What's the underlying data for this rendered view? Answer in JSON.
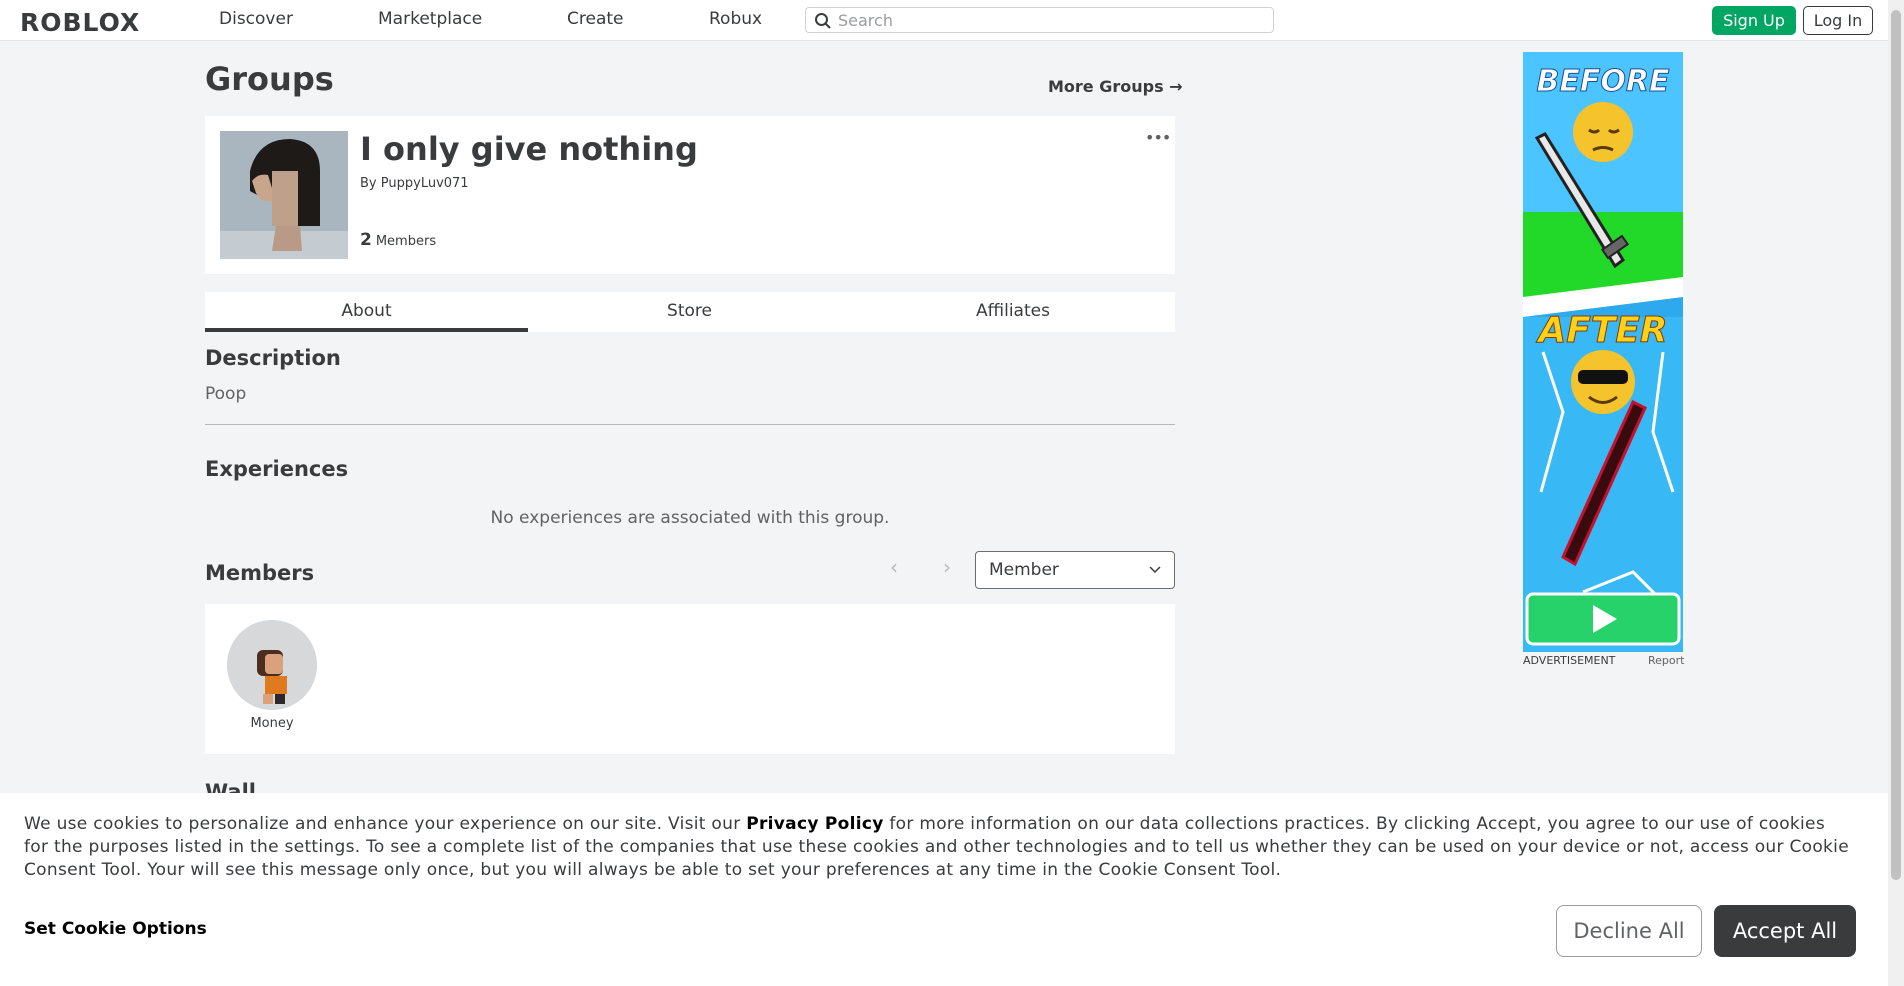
{
  "nav": {
    "logo": "ROBLOX",
    "links": [
      "Discover",
      "Marketplace",
      "Create",
      "Robux"
    ],
    "search_placeholder": "Search",
    "signup": "Sign Up",
    "login": "Log In"
  },
  "page": {
    "title": "Groups",
    "more_groups": "More Groups →"
  },
  "group": {
    "name": "I only give nothing",
    "by_prefix": "By",
    "owner": "PuppyLuv071",
    "member_count": "2",
    "member_label": "Members",
    "menu_icon": "more-dots-icon"
  },
  "tabs": [
    "About",
    "Store",
    "Affiliates"
  ],
  "about": {
    "description_heading": "Description",
    "description": "Poop",
    "experiences_heading": "Experiences",
    "no_experiences": "No experiences are associated with this group.",
    "members_heading": "Members",
    "role_filter": "Member",
    "members": [
      {
        "name": "Money"
      }
    ],
    "wall_heading": "Wall"
  },
  "ad": {
    "before": "BEFORE",
    "after": "AFTER",
    "label": "ADVERTISEMENT",
    "report": "Report"
  },
  "cookie": {
    "text_before": "We use cookies to personalize and enhance your experience on our site. Visit our ",
    "privacy_link": "Privacy Policy",
    "text_after": " for more information on our data collections practices. By clicking Accept, you agree to our use of cookies for the purposes listed in the settings. To see a complete list of the companies that use these cookies and other technologies and to tell us whether they can be used on your device or not, access our Cookie Consent Tool. Your will see this message only once, but you will always be able to set your preferences at any time in the Cookie Consent Tool.",
    "set_options": "Set Cookie Options",
    "decline": "Decline All",
    "accept": "Accept All"
  },
  "colors": {
    "signup_green": "#00a661",
    "accept_dark": "#393b3d",
    "background": "#f2f4f5"
  }
}
